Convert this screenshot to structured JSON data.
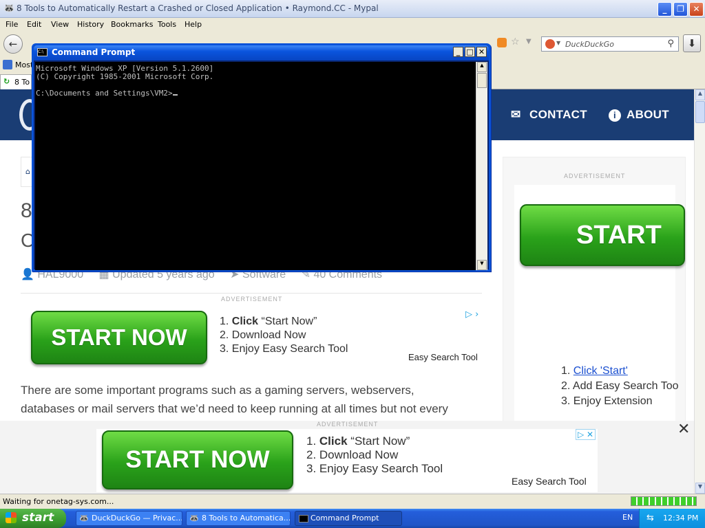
{
  "browser": {
    "title": "8 Tools to Automatically Restart a Crashed or Closed Application • Raymond.CC - Mypal",
    "menu": [
      "File",
      "Edit",
      "View",
      "History",
      "Bookmarks",
      "Tools",
      "Help"
    ],
    "search_placeholder": "DuckDuckGo",
    "bookmark_label": "Most",
    "tab_label": "8 To",
    "status": "Waiting for onetag-sys.com..."
  },
  "site": {
    "nav": {
      "contact": "CONTACT",
      "about": "ABOUT"
    },
    "title_fragment_1": "8",
    "title_fragment_2": "C",
    "meta": {
      "author": "HAL9000",
      "updated": "Updated 5 years ago",
      "category": "Software",
      "comments": "40 Comments"
    },
    "ad_label": "ADVERTISEMENT",
    "inline_ad": {
      "button": "START NOW",
      "step1_bold": "Click",
      "step1_rest": "“Start Now”",
      "step2": "2. Download Now",
      "step3": "3. Enjoy Easy Search Tool",
      "brand": "Easy Search Tool"
    },
    "sidebar_ad": {
      "label": "ADVERTISEMENT",
      "button": "START",
      "step1": "Click 'Start'",
      "step2": "2. Add Easy Search Too",
      "step3": "3. Enjoy Extension"
    },
    "body_line1": "There are some important programs such as a gaming servers, webservers,",
    "body_line2": "databases or mail servers that we’d need to keep running at all times but not every",
    "bottom_ad": {
      "label": "ADVERTISEMENT",
      "button": "START NOW",
      "step1_bold": "Click",
      "step1_rest": "“Start Now”",
      "step2": "2. Download Now",
      "step3": "3. Enjoy Easy Search Tool",
      "brand": "Easy Search Tool"
    }
  },
  "cmd": {
    "title": "Command Prompt",
    "line1": "Microsoft Windows XP [Version 5.1.2600]",
    "line2": "(C) Copyright 1985-2001 Microsoft Corp.",
    "prompt": "C:\\Documents and Settings\\VM2>"
  },
  "taskbar": {
    "start": "start",
    "tasks": [
      "DuckDuckGo — Privac...",
      "8 Tools to Automatica...",
      "Command Prompt"
    ],
    "lang": "EN",
    "clock": "12:34 PM"
  },
  "colors": {
    "site_header": "#1a3d74",
    "ad_green": "#2aa21a",
    "xp_blue": "#245edb"
  }
}
